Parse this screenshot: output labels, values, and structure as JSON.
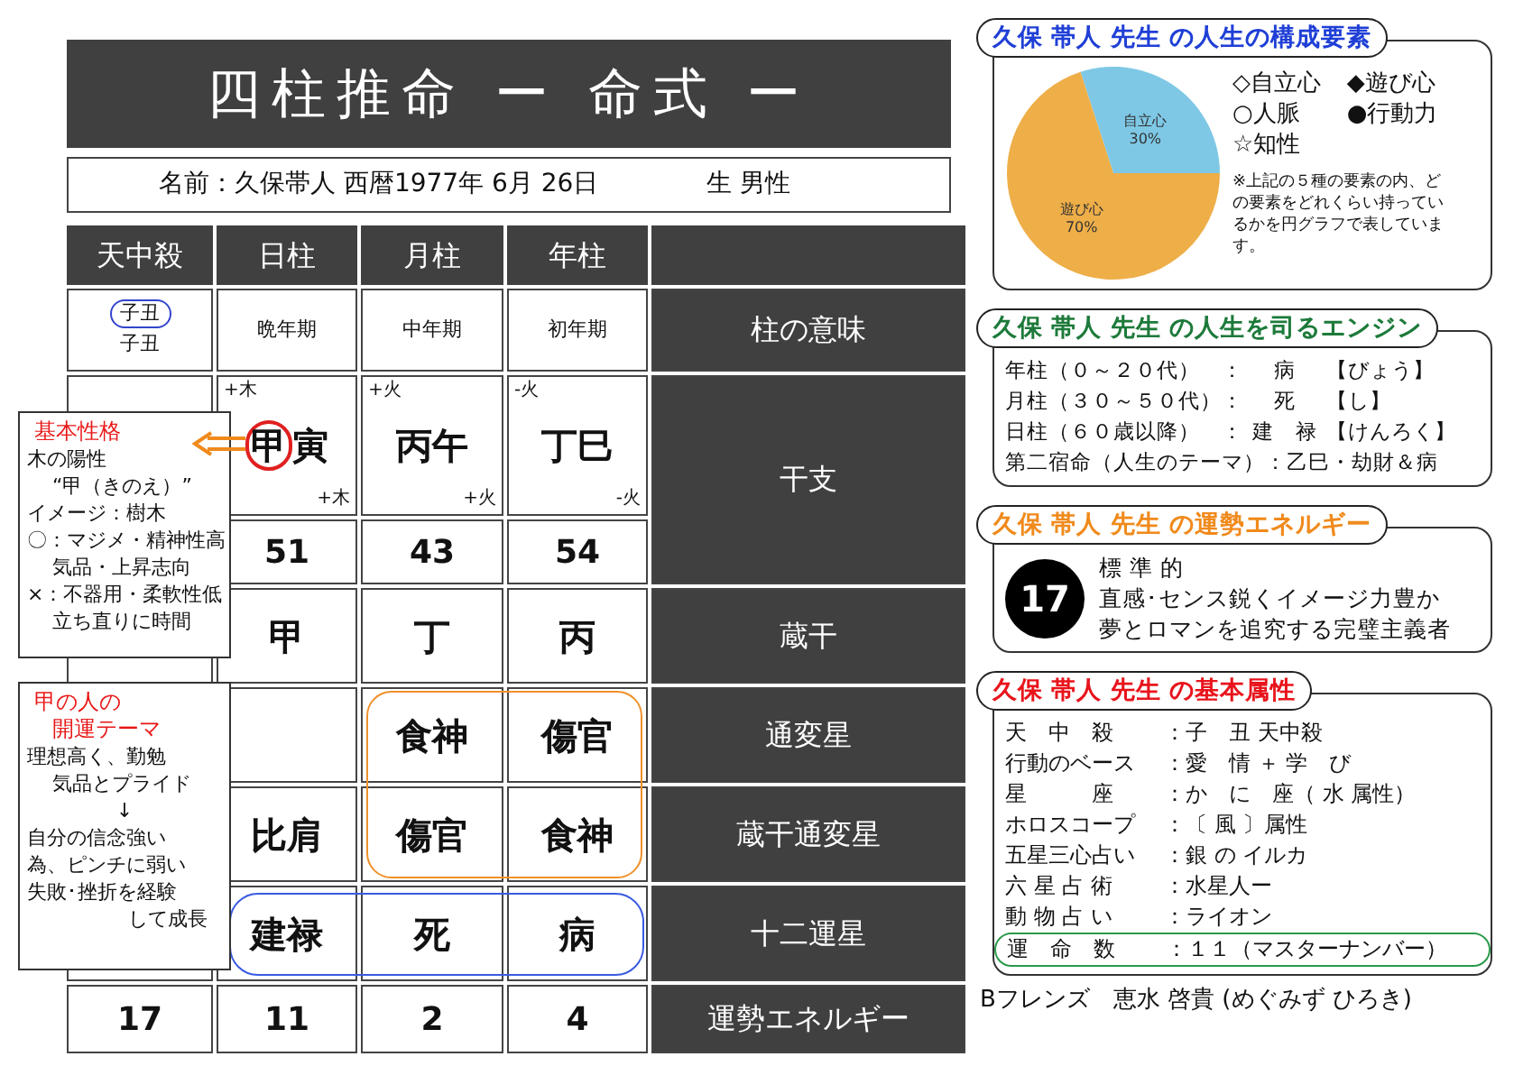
{
  "title": "四柱推命 ー 命式 ー",
  "name_line": {
    "name": "名前：久保帯人 西暦1977年 6月 26日",
    "gender": "生 男性"
  },
  "table": {
    "columns": [
      "天中殺",
      "日柱",
      "月柱",
      "年柱"
    ],
    "rows": [
      {
        "kind": "meaning",
        "label": "柱の意味",
        "tenchusatsu": {
          "badge": "子丑",
          "text": "子丑"
        },
        "day": "晩年期",
        "month": "中年期",
        "year": "初年期"
      },
      {
        "kind": "kanshi",
        "label": "干支",
        "day": {
          "top": "+木",
          "circled": "甲",
          "main": "寅",
          "bottom": "+木",
          "number": "51"
        },
        "month": {
          "top": "+火",
          "main": "丙午",
          "bottom": "+火",
          "number": "43"
        },
        "year": {
          "top": "-火",
          "main": "丁巳",
          "bottom": "-火",
          "number": "54"
        }
      },
      {
        "kind": "big",
        "label": "蔵干",
        "day": "甲",
        "month": "丁",
        "year": "丙"
      },
      {
        "kind": "big",
        "label": "通変星",
        "month": "食神",
        "year": "傷官"
      },
      {
        "kind": "big",
        "label": "蔵干通変星",
        "day": "比肩",
        "month": "傷官",
        "year": "食神"
      },
      {
        "kind": "big",
        "label": "十二運星",
        "day": "建禄",
        "month": "死",
        "year": "病"
      },
      {
        "kind": "energy",
        "label": "運勢エネルギー",
        "tenchusatsu": "17",
        "day": "11",
        "month": "2",
        "year": "4"
      }
    ]
  },
  "notes": [
    {
      "title": [
        "基本性格"
      ],
      "lines": [
        {
          "text": "木の陽性",
          "kind": "line"
        },
        {
          "text": "“甲（きのえ）”",
          "kind": "continued"
        },
        {
          "text": "イメージ：樹木",
          "kind": "line"
        },
        {
          "text": "〇：マジメ・精神性高",
          "kind": "line"
        },
        {
          "text": "気品・上昇志向",
          "kind": "continued"
        },
        {
          "text": "×：不器用・柔軟性低",
          "kind": "line"
        },
        {
          "text": "立ち直りに時間",
          "kind": "continued"
        }
      ]
    },
    {
      "title": [
        "甲の人の",
        "開運テーマ"
      ],
      "lines": [
        {
          "text": "理想高く、勤勉",
          "kind": "line"
        },
        {
          "text": "気品とプライド",
          "kind": "continued"
        },
        {
          "text": "↓",
          "kind": "arrow"
        },
        {
          "text": "自分の信念強い",
          "kind": "line"
        },
        {
          "text": "為、ピンチに弱い",
          "kind": "line"
        },
        {
          "text": "失敗･挫折を経験",
          "kind": "line"
        },
        {
          "text": "して成長",
          "kind": "closing"
        }
      ]
    }
  ],
  "panels": [
    {
      "kind": "composition",
      "title": "久保 帯人 先生 の人生の構成要素",
      "color": "#1f3fd6",
      "chart_data": {
        "type": "pie",
        "categories": [
          "自立心",
          "遊び心"
        ],
        "values": [
          30,
          70
        ],
        "data_labels": true,
        "value_labels": [
          "30%",
          "70%"
        ]
      },
      "legend": [
        "◇自立心",
        "◆遊び心",
        "○人脈",
        "●行動力",
        "☆知性"
      ],
      "note": "※上記の５種の要素の内、どの要素をどれくらい持っているかを円グラフで表しています。"
    },
    {
      "kind": "engine",
      "title": "久保 帯人 先生 の人生を司るエンジン",
      "color": "#1d7a3a",
      "rows": [
        {
          "label": "年柱（０～２０代）",
          "sep": "：",
          "value": "病",
          "reading": "【びょう】"
        },
        {
          "label": "月柱（３０～５０代）",
          "sep": "：",
          "value": "死",
          "reading": "【し】"
        },
        {
          "label": "日柱（６０歳以降）",
          "sep": "：",
          "value": "建　禄",
          "reading": "【けんろく】"
        },
        {
          "label": "第二宿命（人生のテーマ）",
          "sep": "：",
          "value": "乙巳・劫財＆病"
        }
      ]
    },
    {
      "kind": "energy",
      "title": "久保 帯人 先生 の運勢エネルギー",
      "color": "#f08a1c",
      "number": "17",
      "lines": [
        "標 準 的",
        "直感･センス鋭くイメージ力豊か",
        "夢とロマンを追究する完璧主義者"
      ]
    },
    {
      "kind": "attributes",
      "title": "久保 帯人 先生 の基本属性",
      "color": "#e8141c",
      "rows": [
        {
          "label": "天　中　殺",
          "sep": "：",
          "value": "子　丑 天中殺",
          "highlighted": false
        },
        {
          "label": "行動のベース",
          "sep": "：",
          "value": "愛　情 ＋ 学　び",
          "highlighted": false
        },
        {
          "label": "星　　　座",
          "sep": "：",
          "value": "か　に　座（ 水 属性）",
          "highlighted": false
        },
        {
          "label": "ホロスコープ",
          "sep": "：",
          "value": "〔 風 〕属性",
          "highlighted": false
        },
        {
          "label": "五星三心占い",
          "sep": "：",
          "value": "銀 の イルカ",
          "highlighted": false
        },
        {
          "label": "六 星 占 術",
          "sep": "：",
          "value": "水星人ー",
          "highlighted": false
        },
        {
          "label": "動 物 占 い",
          "sep": "：",
          "value": "ライオン",
          "highlighted": false
        },
        {
          "label": "運　命　数",
          "sep": "：",
          "value": "１１（マスターナンバー）",
          "highlighted": true
        }
      ]
    }
  ],
  "footer": "Bフレンズ　恵水 啓貴 (めぐみず ひろき)"
}
